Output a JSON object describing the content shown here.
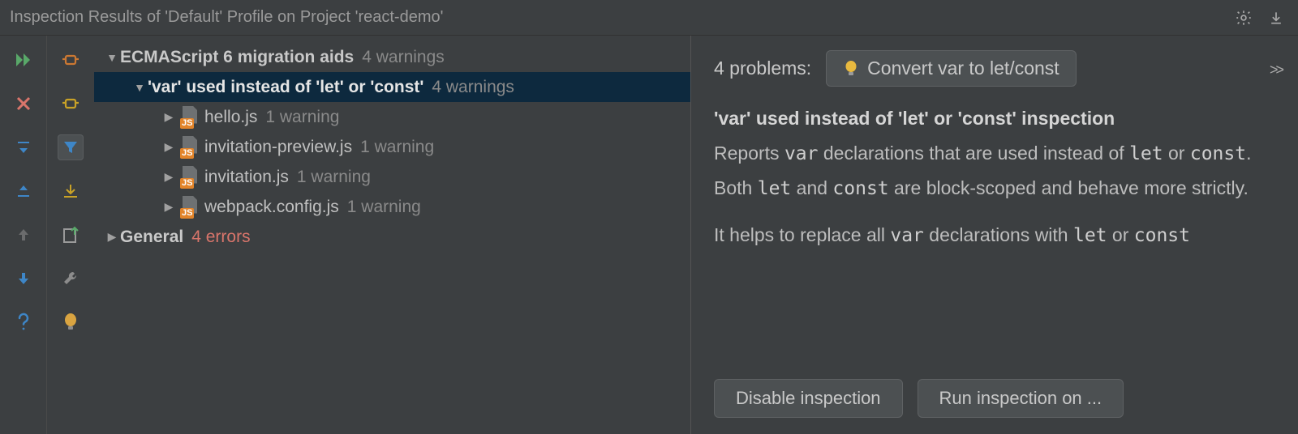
{
  "title": "Inspection Results of 'Default' Profile on Project 'react-demo'",
  "tree": {
    "group1": {
      "label": "ECMAScript 6 migration aids",
      "count": "4 warnings"
    },
    "inspection": {
      "label": "'var' used instead of 'let' or 'const'",
      "count": "4 warnings"
    },
    "files": [
      {
        "name": "hello.js",
        "count": "1 warning"
      },
      {
        "name": "invitation-preview.js",
        "count": "1 warning"
      },
      {
        "name": "invitation.js",
        "count": "1 warning"
      },
      {
        "name": "webpack.config.js",
        "count": "1 warning"
      }
    ],
    "group2": {
      "label": "General",
      "count": "4 errors"
    }
  },
  "detail": {
    "problems": "4 problems:",
    "fix_label": "Convert var to let/const",
    "title": "'var' used instead of 'let' or 'const' inspection",
    "p1a": "Reports ",
    "p1b": "var",
    "p1c": " declarations that are used instead of ",
    "p1d": "let",
    "p1e": " or ",
    "p1f": "const",
    "p1g": ".",
    "p2a": "Both ",
    "p2b": "let",
    "p2c": " and ",
    "p2d": "const",
    "p2e": " are block-scoped and behave more strictly.",
    "p3a": "It helps to replace all ",
    "p3b": "var",
    "p3c": " declarations with ",
    "p3d": "let",
    "p3e": " or ",
    "p3f": "const",
    "disable_btn": "Disable inspection",
    "run_btn": "Run inspection on ..."
  }
}
